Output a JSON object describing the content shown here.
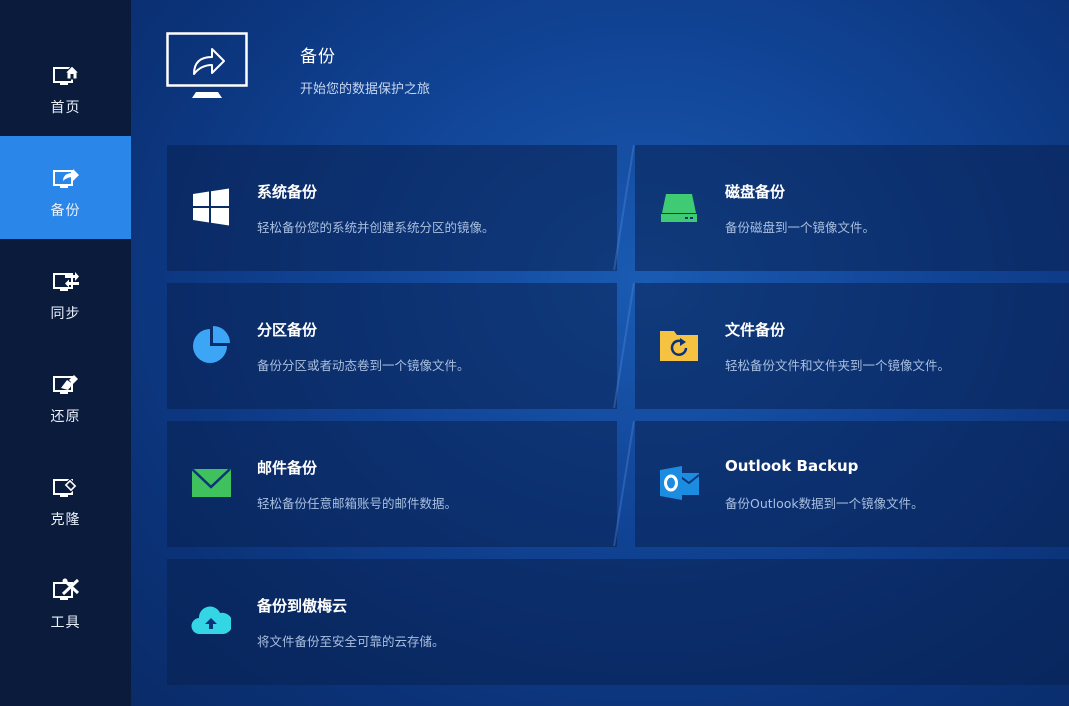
{
  "sidebar": {
    "items": [
      {
        "label": "首页",
        "icon": "home-icon"
      },
      {
        "label": "备份",
        "icon": "backup-icon",
        "active": true
      },
      {
        "label": "同步",
        "icon": "sync-icon"
      },
      {
        "label": "还原",
        "icon": "restore-icon"
      },
      {
        "label": "克隆",
        "icon": "clone-icon"
      },
      {
        "label": "工具",
        "icon": "tools-icon"
      }
    ]
  },
  "header": {
    "title": "备份",
    "subtitle": "开始您的数据保护之旅",
    "icon": "monitor-share-icon"
  },
  "cards": [
    {
      "title": "系统备份",
      "desc": "轻松备份您的系统并创建系统分区的镜像。",
      "icon": "windows-icon"
    },
    {
      "title": "磁盘备份",
      "desc": "备份磁盘到一个镜像文件。",
      "icon": "disk-icon"
    },
    {
      "title": "分区备份",
      "desc": "备份分区或者动态卷到一个镜像文件。",
      "icon": "partition-icon"
    },
    {
      "title": "文件备份",
      "desc": "轻松备份文件和文件夹到一个镜像文件。",
      "icon": "folder-icon"
    },
    {
      "title": "邮件备份",
      "desc": "轻松备份任意邮箱账号的邮件数据。",
      "icon": "mail-icon"
    },
    {
      "title": "Outlook Backup",
      "desc": "备份Outlook数据到一个镜像文件。",
      "icon": "outlook-icon"
    },
    {
      "title": "备份到傲梅云",
      "desc": "将文件备份至安全可靠的云存储。",
      "icon": "cloud-icon"
    }
  ],
  "colors": {
    "sidebar_bg": "#0b1b3b",
    "active": "#2a86e8",
    "windows": "#ffffff",
    "disk": "#3ecb74",
    "partition": "#3da5f5",
    "folder": "#f5c242",
    "mail": "#3fc25d",
    "outlook": "#1c8ce0",
    "cloud": "#34d6e6"
  }
}
